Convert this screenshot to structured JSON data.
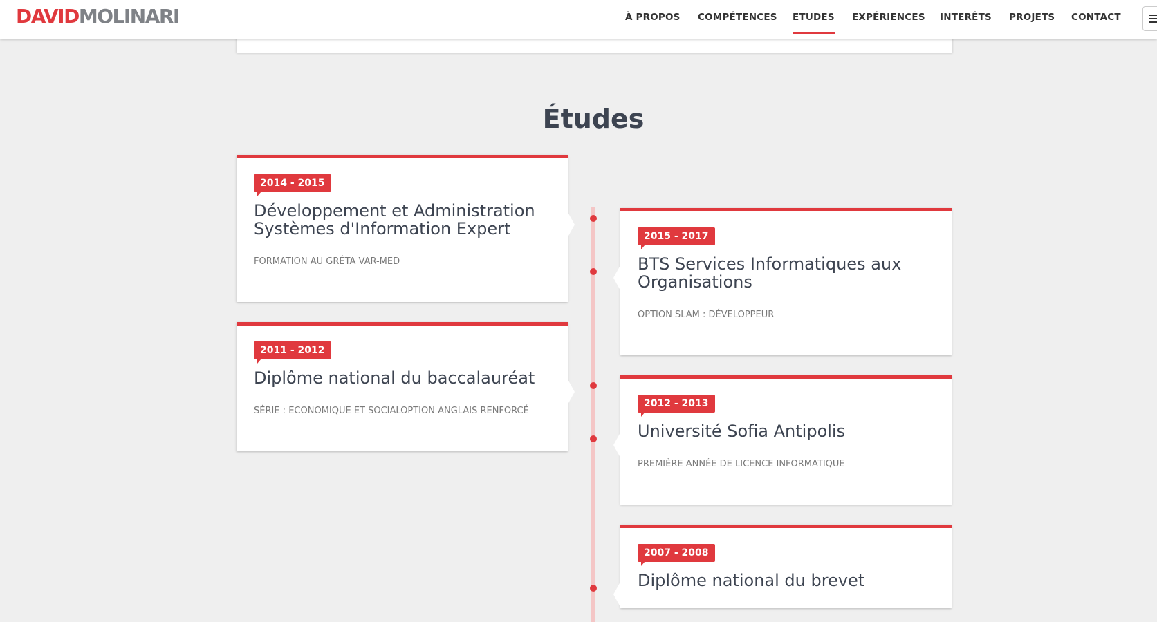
{
  "logo": {
    "first": "DAVID",
    "last": "MOLINARI"
  },
  "nav": {
    "items": [
      {
        "label": "À PROPOS"
      },
      {
        "label": "COMPÉTENCES"
      },
      {
        "label": "ETUDES"
      },
      {
        "label": "EXPÉRIENCES"
      },
      {
        "label": "INTERÊTS"
      },
      {
        "label": "PROJETS"
      },
      {
        "label": "CONTACT"
      }
    ],
    "active": "ETUDES"
  },
  "section": {
    "title": "Études"
  },
  "entries": [
    {
      "date": "2014 - 2015",
      "title": "Développement et Administration Systèmes d'Information Expert",
      "subtitle": "FORMATION AU GRÉTA VAR-MED"
    },
    {
      "date": "2015 - 2017",
      "title": "BTS Services Informatiques aux Organisations",
      "subtitle": "OPTION SLAM : DÉVELOPPEUR"
    },
    {
      "date": "2011 - 2012",
      "title": "Diplôme national du baccalauréat",
      "subtitle": "SÉRIE : ECONOMIQUE ET SOCIALOPTION ANGLAIS RENFORCÉ"
    },
    {
      "date": "2012 - 2013",
      "title": "Université Sofia Antipolis",
      "subtitle": "PREMIÈRE ANNÉE DE LICENCE INFORMATIQUE"
    },
    {
      "date": "2007 - 2008",
      "title": "Diplôme national du brevet",
      "subtitle": ""
    }
  ],
  "colors": {
    "accent": "#e0393e",
    "text": "#3d4451",
    "muted": "#7a7a7a",
    "background": "#efefef"
  }
}
